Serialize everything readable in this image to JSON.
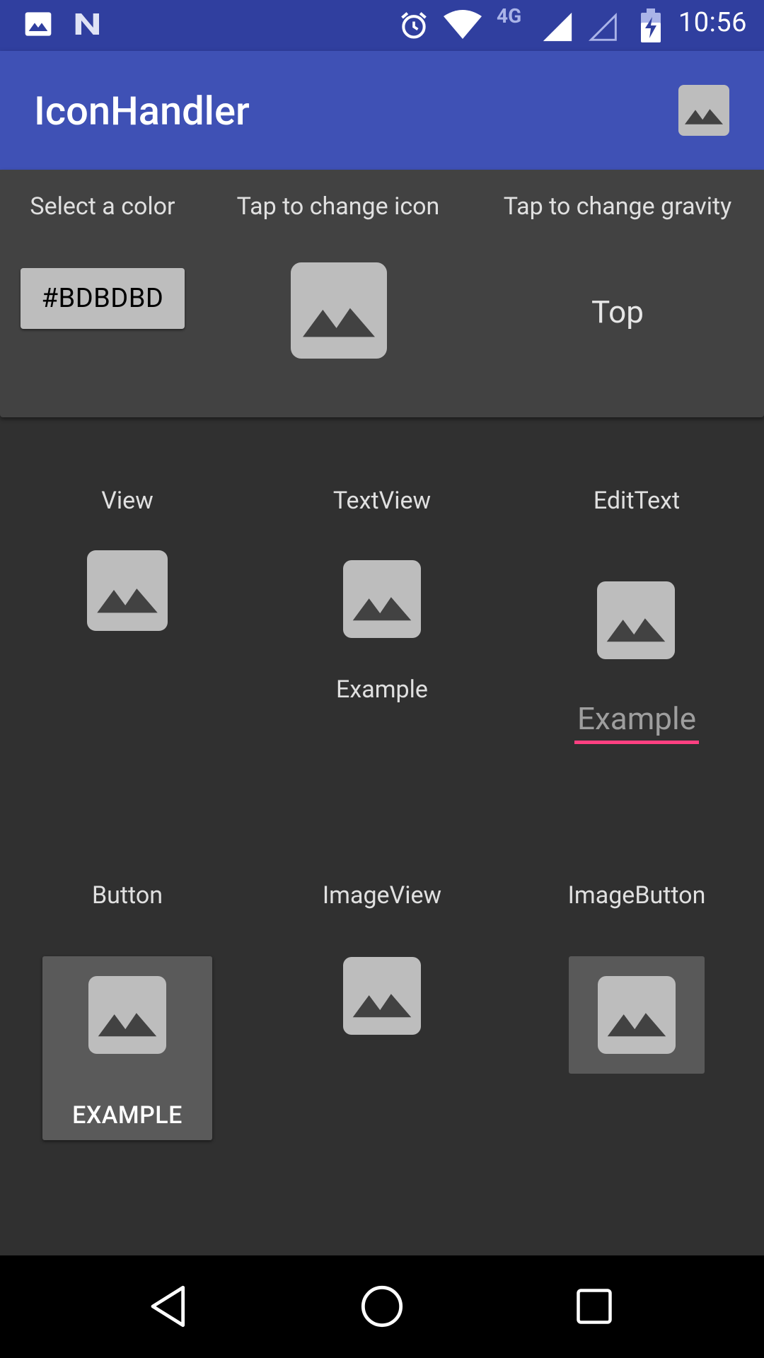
{
  "status_bar": {
    "time": "10:56",
    "network_label": "4G",
    "icons": [
      "image-notification-icon",
      "n-notification-icon",
      "alarm-icon",
      "wifi-icon",
      "signal-icon",
      "signal-empty-icon",
      "battery-charging-icon"
    ]
  },
  "app_bar": {
    "title": "IconHandler",
    "action_icon": "image-icon"
  },
  "controls": {
    "color_label": "Select a color",
    "color_value": "#BDBDBD",
    "icon_label": "Tap to change icon",
    "icon_name": "image-icon",
    "gravity_label": "Tap to change gravity",
    "gravity_value": "Top"
  },
  "demos": {
    "view_label": "View",
    "textview_label": "TextView",
    "textview_text": "Example",
    "edittext_label": "EditText",
    "edittext_text": "Example",
    "button_label": "Button",
    "button_text": "EXAMPLE",
    "imageview_label": "ImageView",
    "imagebutton_label": "ImageButton"
  },
  "nav_bar": {
    "buttons": [
      "back-icon",
      "home-icon",
      "recents-icon"
    ]
  },
  "colors": {
    "status_bar": "#303F9F",
    "app_bar": "#3F51B5",
    "background": "#303030",
    "card": "#424242",
    "icon_tint": "#BDBDBD",
    "accent": "#FF4081"
  }
}
